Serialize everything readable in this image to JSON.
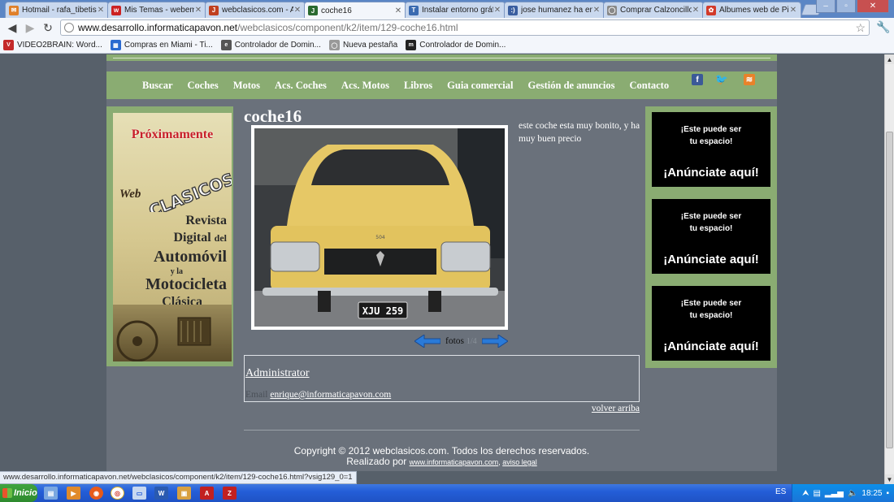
{
  "browser": {
    "tabs": [
      {
        "title": "Hotmail - rafa_tibetis",
        "favicon": "hotmail-icon",
        "color": "#e0802a",
        "glyph": "✉",
        "active": false
      },
      {
        "title": "Mis Temas - webempr",
        "favicon": "webempresa-icon",
        "color": "#cc2222",
        "glyph": "w",
        "active": false
      },
      {
        "title": "webclasicos.com - Ad",
        "favicon": "joomla-icon",
        "color": "#c04020",
        "glyph": "J",
        "active": false
      },
      {
        "title": "coche16",
        "favicon": "joomla-icon",
        "color": "#2a6a30",
        "glyph": "J",
        "active": true
      },
      {
        "title": "Instalar entorno gráf",
        "favicon": "document-icon",
        "color": "#3a6ab0",
        "glyph": "T",
        "active": false
      },
      {
        "title": "jose humanez ha envi",
        "favicon": "forum-icon",
        "color": "#3a5ea0",
        "glyph": ":)",
        "active": false
      },
      {
        "title": "Comprar Calzoncillos",
        "favicon": "globe-icon",
        "color": "#888888",
        "glyph": "◯",
        "active": false
      },
      {
        "title": "Álbumes web de Picas",
        "favicon": "picasa-icon",
        "color": "#d23a2a",
        "glyph": "✿",
        "active": false
      }
    ],
    "url_host": "www.desarrollo.informaticapavon.net",
    "url_path": "/webclasicos/component/k2/item/129-coche16.html",
    "bookmarks": [
      {
        "label": "VIDEO2BRAIN: Word...",
        "icon": "video2brain-icon",
        "color": "#c42a2a",
        "glyph": "V"
      },
      {
        "label": "Compras en Miami - Ti...",
        "icon": "compras-icon",
        "color": "#2a6ad0",
        "glyph": "▦"
      },
      {
        "label": "Controlador de Domin...",
        "icon": "controlador-icon",
        "color": "#555555",
        "glyph": "e"
      },
      {
        "label": "Nueva pestaña",
        "icon": "globe-icon",
        "color": "#999999",
        "glyph": "◯"
      },
      {
        "label": "Controlador de Domin...",
        "icon": "controlador-icon",
        "color": "#222222",
        "glyph": "m"
      }
    ],
    "status_url": "www.desarrollo.informaticapavon.net/webclasicos/component/k2/item/129-coche16.html?vsig129_0=1"
  },
  "site": {
    "menu": [
      "Buscar",
      "Coches",
      "Motos",
      "Acs. Coches",
      "Acs. Motos",
      "Libros",
      "Guia comercial",
      "Gestión de anuncios",
      "Contacto"
    ],
    "promo": {
      "proximamente": "Próximamente",
      "logo_web": "Web",
      "logo_clasicos": "CLASICOS",
      "line1": "Revista",
      "line2": "Digital",
      "line2b": "del",
      "line3": "Automóvil",
      "line3b": "y la",
      "line4": "Motocicleta",
      "line5": "Clásica"
    },
    "item": {
      "title": "coche16",
      "description": "este coche esta muy bonito, y ha muy buen precio",
      "plate": "XJU 259",
      "gallery_label": "fotos",
      "gallery_count": "1/4",
      "author": "Administrator",
      "email_label": "Email",
      "email": "enrique@informaticapavon.com",
      "back_to_top": "volver arriba"
    },
    "ads": [
      {
        "line1": "¡Este puede ser",
        "line2": "tu espacio!",
        "cta": "¡Anúnciate aquí!"
      },
      {
        "line1": "¡Este puede ser",
        "line2": "tu espacio!",
        "cta": "¡Anúnciate aquí!"
      },
      {
        "line1": "¡Este puede ser",
        "line2": "tu espacio!",
        "cta": "¡Anúnciate aquí!"
      }
    ],
    "footer": {
      "copyright": "Copyright © 2012 webclasicos.com. Todos los derechos reservados.",
      "made_by": "Realizado por",
      "made_by_link": "www.informaticapavon.com",
      "legal": "aviso legal"
    },
    "colors": {
      "menu_green": "#8aac72",
      "page_gray": "#6a717b"
    }
  },
  "taskbar": {
    "start": "Inicio",
    "language": "ES",
    "clock": "18:25"
  }
}
